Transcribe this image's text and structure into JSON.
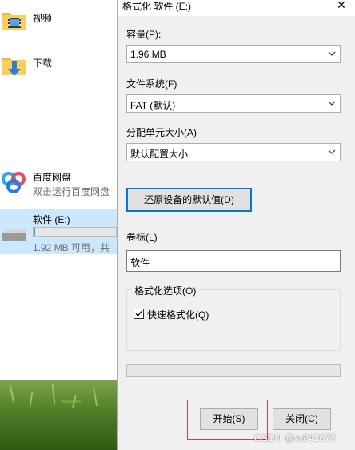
{
  "explorer": {
    "folders": [
      {
        "label": "视频",
        "icon": "video-folder-icon"
      },
      {
        "label": "下载",
        "icon": "download-folder-icon"
      }
    ],
    "baidu": {
      "name": "百度网盘",
      "desc": "双击运行百度网盘",
      "icon": "baidu-netdisk-icon"
    },
    "drive": {
      "name": "软件 (E:)",
      "space": "1.92 MB 可用，共",
      "used_fraction": 0.02,
      "icon": "usb-drive-icon"
    }
  },
  "dialog": {
    "title": "格式化 软件 (E:)",
    "close_glyph": "✕",
    "capacity": {
      "label": "容量(P):",
      "value": "1.96 MB"
    },
    "filesystem": {
      "label": "文件系统(F)",
      "value": "FAT (默认)"
    },
    "allocation": {
      "label": "分配单元大小(A)",
      "value": "默认配置大小"
    },
    "restore_button": "还原设备的默认值(D)",
    "volume": {
      "label": "卷标(L)",
      "value": "软件"
    },
    "options": {
      "legend": "格式化选项(O)",
      "quick_format": {
        "label": "快速格式化(Q)",
        "checked": true
      }
    },
    "progress": 0,
    "start_button": "开始(S)",
    "close_button": "关闭(C)"
  },
  "watermark": "CSDN @xx842678",
  "colors": {
    "accent": "#0078d7",
    "highlight": "#e03a3a",
    "selection": "#cce8ff",
    "dialog_bg": "#f0f0f0"
  }
}
